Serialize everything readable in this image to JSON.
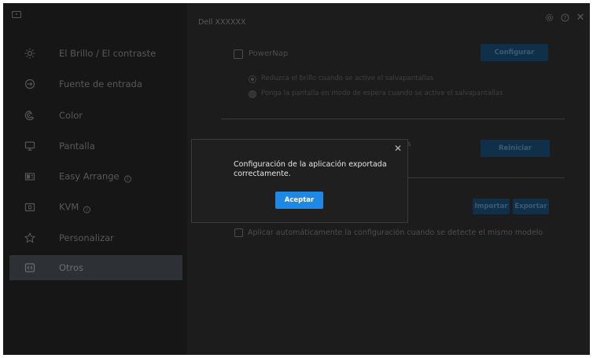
{
  "window": {
    "title": "Dell XXXXXX"
  },
  "sidebar": {
    "items": [
      {
        "label": "El Brillo / El contraste",
        "icon": "brightness-icon"
      },
      {
        "label": "Fuente de entrada",
        "icon": "input-source-icon"
      },
      {
        "label": "Color",
        "icon": "color-palette-icon"
      },
      {
        "label": "Pantalla",
        "icon": "monitor-icon"
      },
      {
        "label": "Easy Arrange",
        "icon": "easy-arrange-icon",
        "info": "ⓘ"
      },
      {
        "label": "KVM",
        "icon": "kvm-icon",
        "info": "ⓘ"
      },
      {
        "label": "Personalizar",
        "icon": "star-icon"
      },
      {
        "label": "Otros",
        "icon": "others-icon",
        "active": true
      }
    ]
  },
  "controls": {
    "settings": "⚙",
    "help": "?",
    "close": "✕"
  },
  "main": {
    "powernap": {
      "label": "PowerNap",
      "button": "Configurar",
      "option_dim": "Reduzca el brillo cuando se active el salvapantallas",
      "option_standby": "Ponga la pantalla en modo de espera cuando se active el salvapantallas"
    },
    "reset": {
      "button": "Reiniciar",
      "partial_text": "s"
    },
    "config": {
      "import_button": "Importar",
      "export_button": "Exportar",
      "auto_apply_label": "Aplicar automáticamente la configuración cuando se detecte el mismo modelo"
    }
  },
  "modal": {
    "message_line1": "Configuración de la aplicación exportada",
    "message_line2": "correctamente.",
    "ok_button": "Aceptar",
    "close": "✕"
  },
  "colors": {
    "accent": "#1e88e5",
    "window_bg": "#1c1c1c",
    "sidebar_bg": "#161616",
    "active_item_bg": "#2d3035"
  }
}
